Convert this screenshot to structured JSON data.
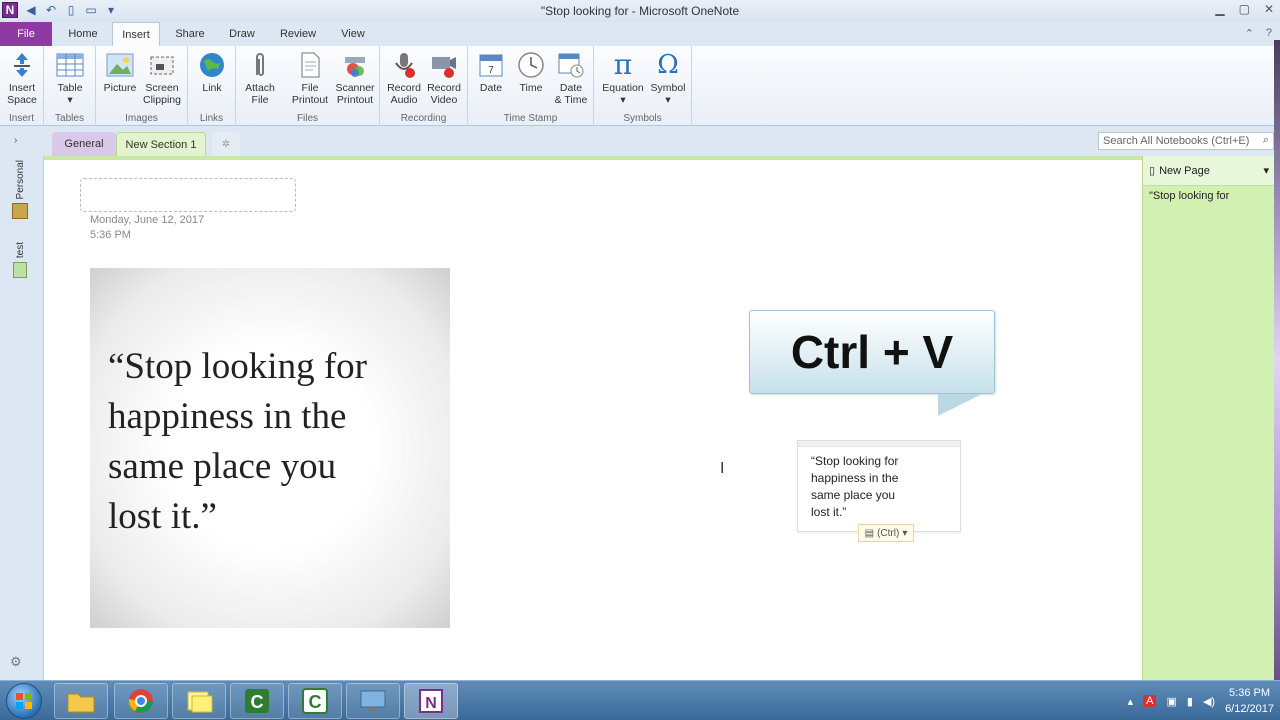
{
  "window": {
    "title": "\"Stop looking for  -  Microsoft OneNote"
  },
  "ribbon_tabs": [
    "File",
    "Home",
    "Insert",
    "Share",
    "Draw",
    "Review",
    "View"
  ],
  "ribbon": {
    "insert_space": [
      "Insert",
      "Space"
    ],
    "table": "Table",
    "picture": "Picture",
    "screen_clipping": [
      "Screen",
      "Clipping"
    ],
    "link": "Link",
    "attach_file": [
      "Attach",
      "File"
    ],
    "file_printout": [
      "File",
      "Printout"
    ],
    "scanner_printout": [
      "Scanner",
      "Printout"
    ],
    "record_audio": [
      "Record",
      "Audio"
    ],
    "record_video": [
      "Record",
      "Video"
    ],
    "date": "Date",
    "time": "Time",
    "date_time": [
      "Date",
      "& Time"
    ],
    "equation": "Equation",
    "symbol": "Symbol",
    "groups": {
      "insert": "Insert",
      "tables": "Tables",
      "images": "Images",
      "links": "Links",
      "files": "Files",
      "recording": "Recording",
      "time_stamp": "Time Stamp",
      "symbols": "Symbols"
    }
  },
  "sections": {
    "general": "General",
    "new_section": "New Section 1",
    "add": "✲"
  },
  "search": {
    "placeholder": "Search All Notebooks (Ctrl+E)"
  },
  "notebooks": {
    "personal": "Personal",
    "test": "test"
  },
  "page": {
    "date": "Monday, June 12, 2017",
    "time": "5:36 PM",
    "quote_image_lines": [
      "“Stop looking for",
      "happiness in the",
      "same place you",
      "lost it.”"
    ],
    "callout": "Ctrl + V",
    "note_lines": [
      "“Stop looking for",
      "happiness in the",
      "same place you",
      "lost it.”"
    ],
    "paste_options": "(Ctrl)"
  },
  "page_panel": {
    "new_page": "New Page",
    "page_title": "\"Stop looking for"
  },
  "taskbar": {
    "time": "5:36 PM",
    "date": "6/12/2017"
  }
}
